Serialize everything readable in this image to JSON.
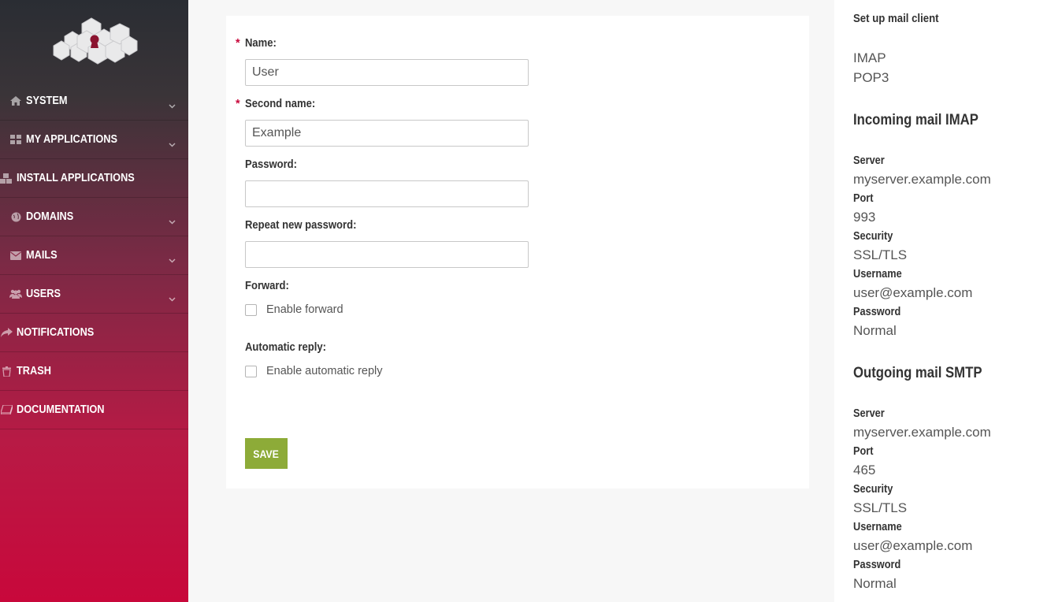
{
  "sidebar": {
    "logo_name": "cloud-keyhole-logo",
    "items": [
      {
        "label": "System",
        "icon": "home-icon"
      },
      {
        "label": "My applications",
        "icon": "grid-icon"
      },
      {
        "label": "Install applications",
        "icon": "cubes-icon"
      },
      {
        "label": "Domains",
        "icon": "globe-icon"
      },
      {
        "label": "Mails",
        "icon": "envelope-icon"
      },
      {
        "label": "Users",
        "icon": "users-icon"
      },
      {
        "label": "Notifications",
        "icon": "share-icon"
      },
      {
        "label": "Trash",
        "icon": "trash-icon"
      },
      {
        "label": "Documentation",
        "icon": "book-icon"
      }
    ],
    "gradient_top": "#2a2d33",
    "gradient_bottom": "#c8083b"
  },
  "form": {
    "name_label": "Name:",
    "name_value": "User",
    "second_name_label": "Second name:",
    "second_name_value": "Example",
    "password_label": "Password:",
    "password_value": "",
    "repeat_password_label": "Repeat new password:",
    "repeat_password_value": "",
    "forward_label": "Forward:",
    "enable_forward_label": "Enable forward",
    "auto_reply_label": "Automatic reply:",
    "enable_auto_reply_label": "Enable automatic reply",
    "required_mark": "*",
    "save_label": "Save",
    "save_color": "#8dab38",
    "required_color": "#c8083b"
  },
  "mail_client": {
    "title": "Set up mail client",
    "links": [
      "IMAP",
      "POP3"
    ],
    "incoming": {
      "heading": "Incoming mail IMAP",
      "server_key": "Server",
      "server": "myserver.example.com",
      "port_key": "Port",
      "port": "993",
      "security_key": "Security",
      "security": "SSL/TLS",
      "username_key": "Username",
      "username": "user@example.com",
      "password_key": "Password",
      "password": "Normal"
    },
    "outgoing": {
      "heading": "Outgoing mail SMTP",
      "server_key": "Server",
      "server": "myserver.example.com",
      "port_key": "Port",
      "port": "465",
      "security_key": "Security",
      "security": "SSL/TLS",
      "username_key": "Username",
      "username": "user@example.com",
      "password_key": "Password",
      "password": "Normal"
    }
  }
}
